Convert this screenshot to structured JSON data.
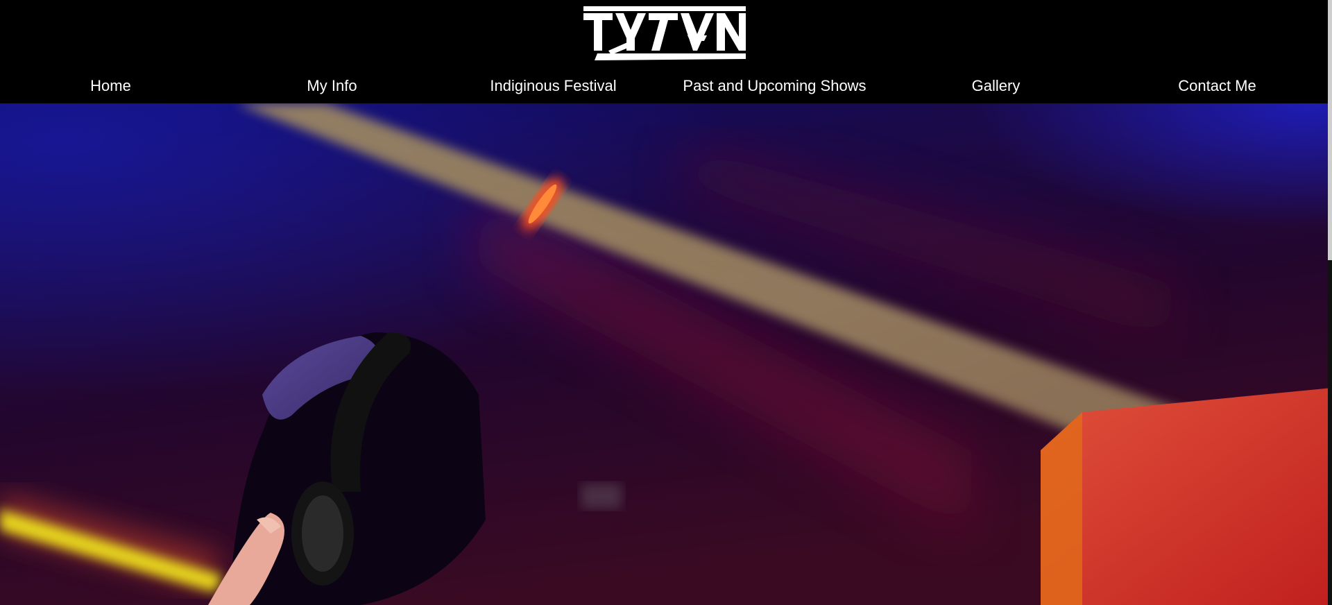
{
  "brand": {
    "logo_text": "TYTAN",
    "logo_color": "#ffffff"
  },
  "nav": {
    "items": [
      {
        "label": "Home"
      },
      {
        "label": "My Info"
      },
      {
        "label": "Indiginous Festival"
      },
      {
        "label": "Past and Upcoming Shows"
      },
      {
        "label": "Gallery"
      },
      {
        "label": "Contact Me"
      }
    ]
  },
  "hero": {
    "image_subject": "DJ wearing headphones and cap under stage lights",
    "colors": {
      "background_top": "#0a0a5a",
      "background_mid": "#24062f",
      "background_bottom": "#3a0a24",
      "light_beam": "#b59a6a",
      "red_beam": "#8a0f3a",
      "yellow_beam": "#e5d21a",
      "lamp": "#ff4a1a",
      "speaker_box": "#d8302a"
    }
  },
  "theme": {
    "header_bg": "#000000",
    "nav_text": "#ffffff"
  }
}
